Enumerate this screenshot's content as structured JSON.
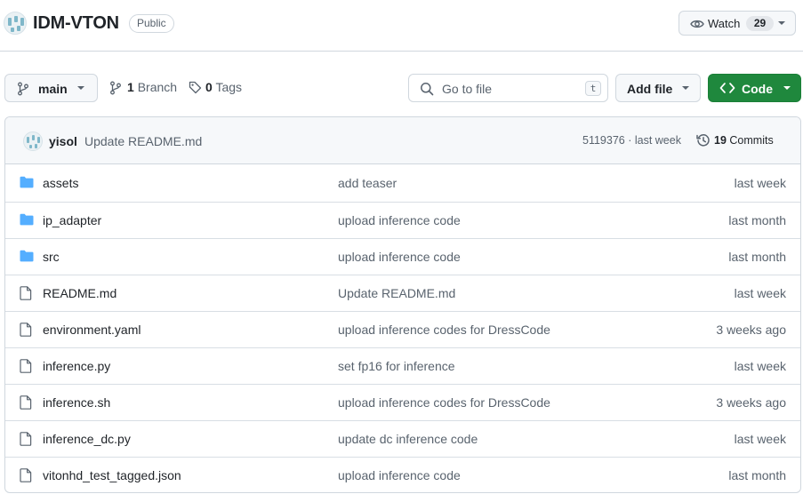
{
  "repo": {
    "name": "IDM-VTON",
    "visibility": "Public",
    "watch_label": "Watch",
    "watch_count": "29"
  },
  "toolbar": {
    "branch": "main",
    "branch_count": "1",
    "branch_label": "Branch",
    "tag_count": "0",
    "tag_label": "Tags",
    "search_placeholder": "Go to file",
    "search_shortcut": "t",
    "add_file_label": "Add file",
    "code_label": "Code",
    "accent_color": "#1f883d"
  },
  "latest_commit": {
    "author": "yisol",
    "message": "Update README.md",
    "meta": "5119376 · last week",
    "commit_count": "19",
    "commit_label": "Commits"
  },
  "files": [
    {
      "type": "folder",
      "icon": "folder-icon",
      "name": "assets",
      "message": "add teaser",
      "age": "last week"
    },
    {
      "type": "folder",
      "icon": "folder-icon",
      "name": "ip_adapter",
      "message": "upload inference code",
      "age": "last month"
    },
    {
      "type": "folder",
      "icon": "folder-icon",
      "name": "src",
      "message": "upload inference code",
      "age": "last month"
    },
    {
      "type": "file",
      "icon": "file-icon",
      "name": "README.md",
      "message": "Update README.md",
      "age": "last week"
    },
    {
      "type": "file",
      "icon": "file-icon",
      "name": "environment.yaml",
      "message": "upload inference codes for DressCode",
      "age": "3 weeks ago"
    },
    {
      "type": "file",
      "icon": "file-icon",
      "name": "inference.py",
      "message": "set fp16 for inference",
      "age": "last week"
    },
    {
      "type": "file",
      "icon": "file-icon",
      "name": "inference.sh",
      "message": "upload inference codes for DressCode",
      "age": "3 weeks ago"
    },
    {
      "type": "file",
      "icon": "file-icon",
      "name": "inference_dc.py",
      "message": "update dc inference code",
      "age": "last week"
    },
    {
      "type": "file",
      "icon": "file-icon",
      "name": "vitonhd_test_tagged.json",
      "message": "upload inference code",
      "age": "last month"
    }
  ]
}
